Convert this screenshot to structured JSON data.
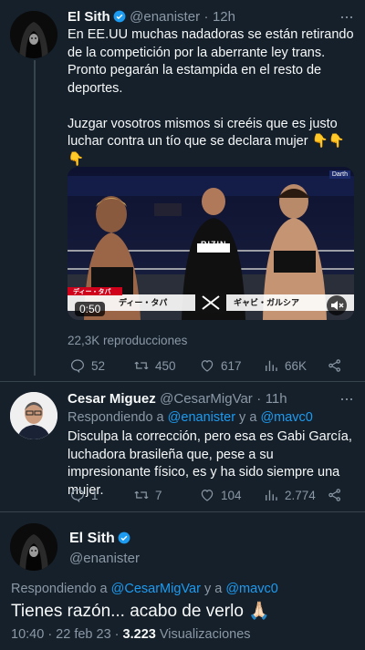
{
  "tweet1": {
    "name": "El Sith",
    "handle": "@enanister",
    "time": "12h",
    "text": "En EE.UU muchas nadadoras se están retirando de la competición por la aberrante ley trans.\nPronto pegarán la estampida en el resto de deportes.\n\nJuzgar vosotros mismos si creéis que es justo luchar contra un tío que se declara mujer 👇👇👇\n👇👇",
    "video": {
      "duration": "0:50",
      "caption_left": "ディー・タパ",
      "caption_right": "ギャビ・ガルシア",
      "caption_red": "ディー・タパ",
      "brand": "RIZIN",
      "corner_label": "Darth"
    },
    "views": "22,3K reproducciones",
    "stats": {
      "replies": "52",
      "retweets": "450",
      "likes": "617",
      "views": "66K"
    }
  },
  "tweet2": {
    "name": "Cesar Miguez",
    "handle": "@CesarMigVar",
    "time": "11h",
    "replying_prefix": "Respondiendo a ",
    "replying_to_1": "@enanister",
    "replying_and": " y a ",
    "replying_to_2": "@mavc0",
    "text": "Disculpa la corrección, pero esa es Gabi García, luchadora brasileña que, pese a su impresionante físico, es y ha sido siempre una mujer.",
    "stats": {
      "replies": "1",
      "retweets": "7",
      "likes": "104",
      "views": "2.774"
    }
  },
  "tweet3": {
    "name": "El Sith",
    "handle": "@enanister",
    "replying_prefix": "Respondiendo a ",
    "replying_to_1": "@CesarMigVar",
    "replying_and": " y a ",
    "replying_to_2": "@mavc0",
    "text": "Tienes razón... acabo de verlo 🙏🏻",
    "time": "10:40 · 22 feb 23 · ",
    "views_count": "3.223",
    "views_label": " Visualizaciones"
  },
  "colors": {
    "background": "#15202b",
    "accent": "#1d9bf0",
    "muted": "#8b98a5",
    "divider": "#38444d"
  }
}
